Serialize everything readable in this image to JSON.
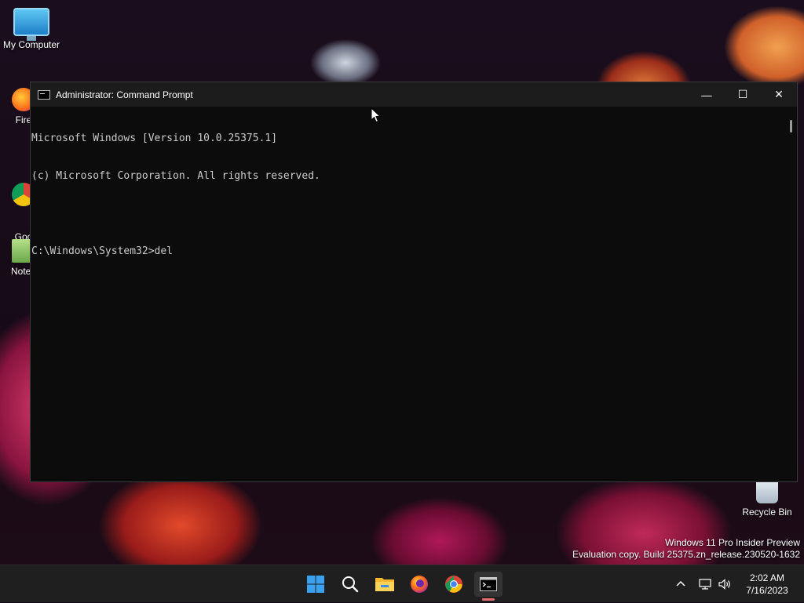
{
  "desktop": {
    "icons": [
      {
        "label": "My Computer"
      },
      {
        "label": "Fire"
      },
      {
        "label": "Goo\nChro"
      },
      {
        "label": "Notep"
      },
      {
        "label": "Recycle Bin"
      }
    ],
    "watermark": {
      "line1": "Windows 11 Pro Insider Preview",
      "line2": "Evaluation copy. Build 25375.zn_release.230520-1632"
    }
  },
  "window": {
    "title": "Administrator: Command Prompt",
    "controls": {
      "minimize": "—",
      "maximize": "☐",
      "close": "✕"
    },
    "console_lines": [
      "Microsoft Windows [Version 10.0.25375.1]",
      "(c) Microsoft Corporation. All rights reserved.",
      "",
      "C:\\Windows\\System32>del"
    ]
  },
  "taskbar": {
    "clock_time": "2:02 AM",
    "clock_date": "7/16/2023",
    "tray_chevron": "^"
  },
  "colors": {
    "console_bg": "#0c0c0c",
    "console_text": "#cccccc",
    "taskbar_bg": "#1f1f1f",
    "active_indicator": "#e96f6f"
  }
}
